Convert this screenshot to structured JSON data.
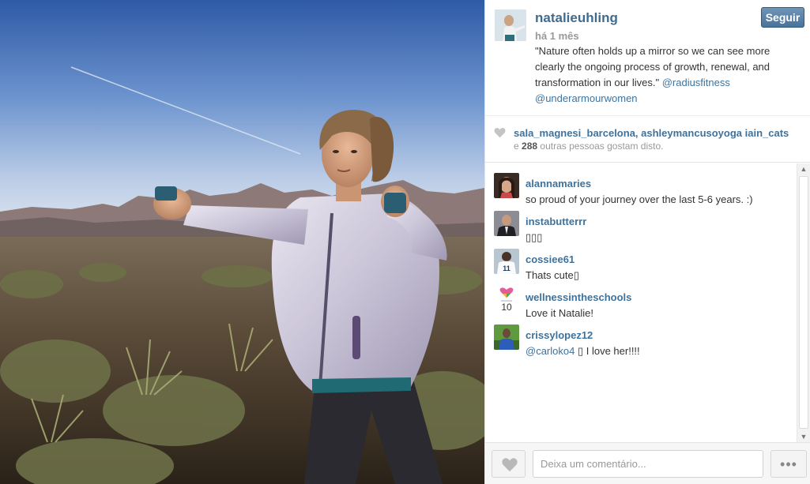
{
  "post": {
    "username": "natalieuhling",
    "follow_label": "Seguir",
    "time": "há 1 mês",
    "caption_text": "\"Nature often holds up a mirror so we can see more clearly the ongoing process of growth, renewal, and transformation in our lives.\"",
    "caption_mention_1": "@radiusfitness",
    "caption_mention_2": "@underarmourwomen"
  },
  "likes": {
    "likers": "sala_magnesi_barcelona, ashleymancusoyoga iain_cats",
    "prefix": "e",
    "count": "288",
    "suffix": "outras pessoas gostam disto."
  },
  "comments": [
    {
      "user": "alannamaries",
      "text": "so proud of your journey over the last 5-6 years. :)"
    },
    {
      "user": "instabutterrr",
      "text": "▯▯▯"
    },
    {
      "user": "cossiee61",
      "text": "Thats cute▯"
    },
    {
      "user": "wellnessintheschools",
      "text": "Love it Natalie!"
    },
    {
      "user": "crissylopez12",
      "mention": "@carloko4",
      "text": "▯ I love her!!!!"
    }
  ],
  "footer": {
    "comment_placeholder": "Deixa um comentário...",
    "more_label": "•••"
  },
  "colors": {
    "link": "#3f729b",
    "follow_button": "#4a739a"
  }
}
